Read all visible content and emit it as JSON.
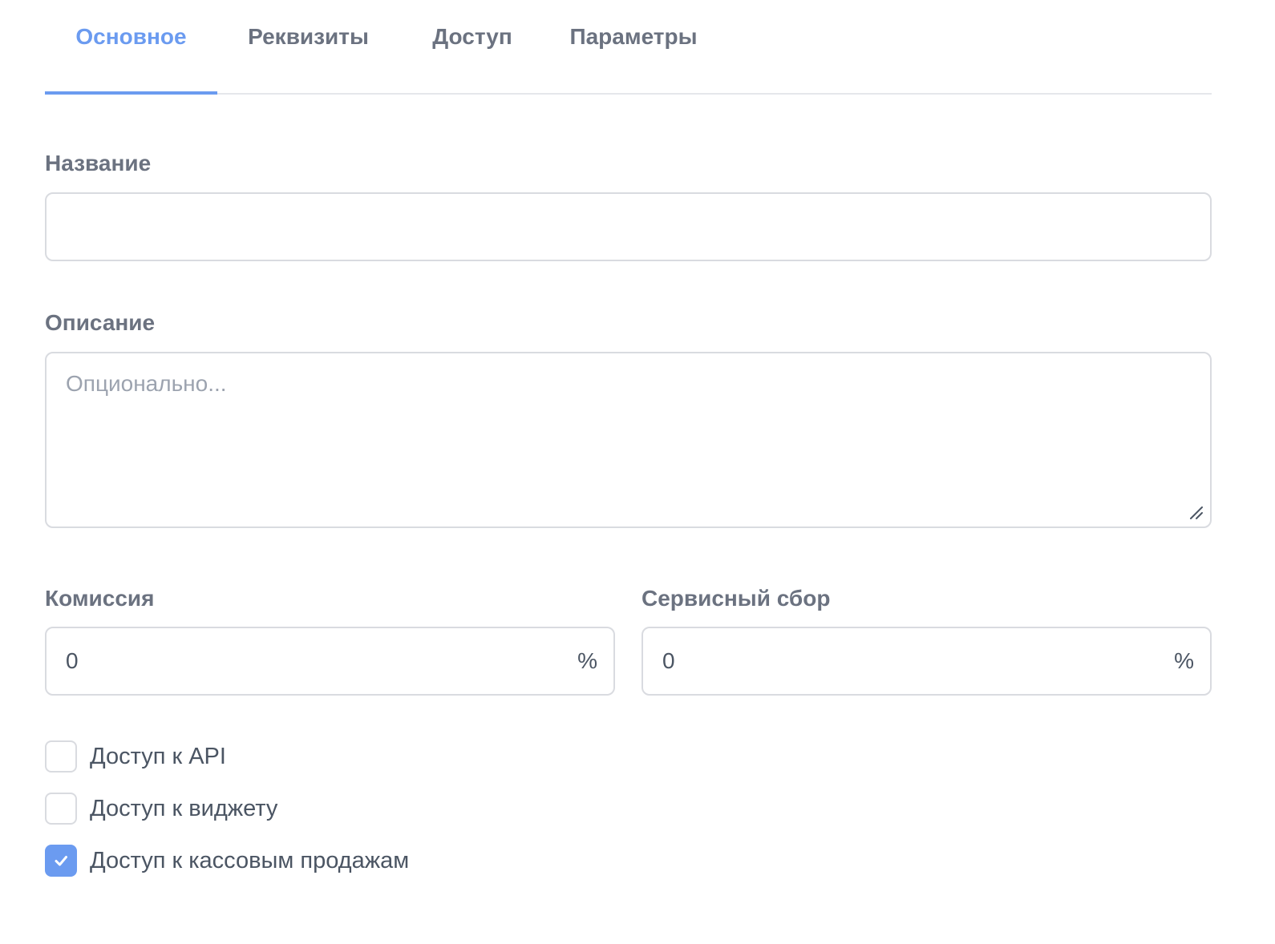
{
  "tabs": [
    {
      "label": "Основное",
      "active": true
    },
    {
      "label": "Реквизиты",
      "active": false
    },
    {
      "label": "Доступ",
      "active": false
    },
    {
      "label": "Параметры",
      "active": false
    }
  ],
  "form": {
    "name": {
      "label": "Название",
      "value": ""
    },
    "description": {
      "label": "Описание",
      "placeholder": "Опционально...",
      "value": ""
    },
    "commission": {
      "label": "Комиссия",
      "value": "0",
      "suffix": "%"
    },
    "service_fee": {
      "label": "Сервисный сбор",
      "value": "0",
      "suffix": "%"
    }
  },
  "checkboxes": [
    {
      "label": "Доступ к API",
      "checked": false
    },
    {
      "label": "Доступ к виджету",
      "checked": false
    },
    {
      "label": "Доступ к кассовым продажам",
      "checked": true
    }
  ],
  "colors": {
    "accent": "#6b9bf0",
    "text": "#6b7280",
    "border": "#d9dbe0"
  },
  "icons": {
    "check": "check-icon",
    "resize": "resize-handle-icon"
  }
}
